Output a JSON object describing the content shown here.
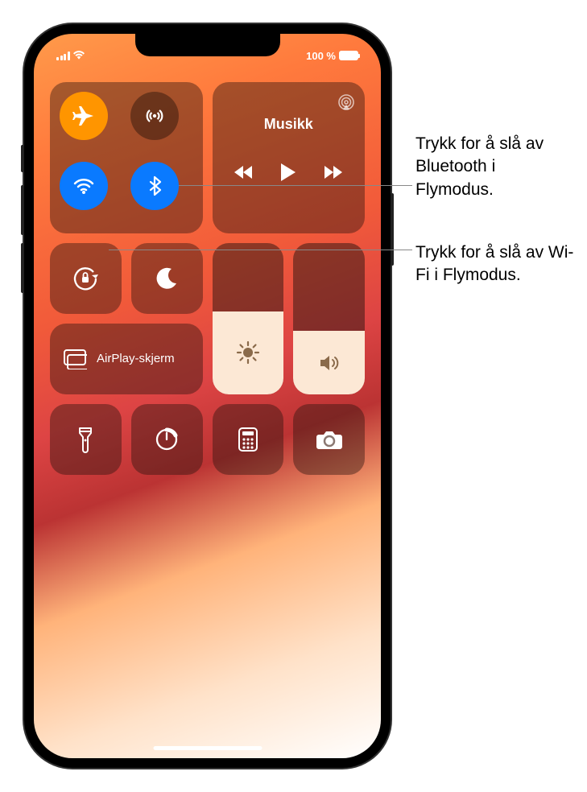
{
  "status": {
    "battery_percent": "100 %"
  },
  "connectivity": {
    "airplane": "airplane-icon",
    "cellular": "cellular-data-icon",
    "wifi": "wifi-icon",
    "bluetooth": "bluetooth-icon"
  },
  "media": {
    "title": "Musikk",
    "airplay_icon": "airplay-audio-icon"
  },
  "rotation_lock": "rotation-lock-icon",
  "dnd": "do-not-disturb-icon",
  "airplay": {
    "label": "AirPlay-skjerm"
  },
  "sliders": {
    "brightness": {
      "percent": 55
    },
    "volume": {
      "percent": 42
    }
  },
  "buttons": {
    "flashlight": "flashlight-icon",
    "timer": "timer-icon",
    "calculator": "calculator-icon",
    "camera": "camera-icon"
  },
  "callouts": {
    "bluetooth": "Trykk for å slå av Bluetooth i Flymodus.",
    "wifi": "Trykk for å slå av Wi-Fi i Flymodus."
  }
}
